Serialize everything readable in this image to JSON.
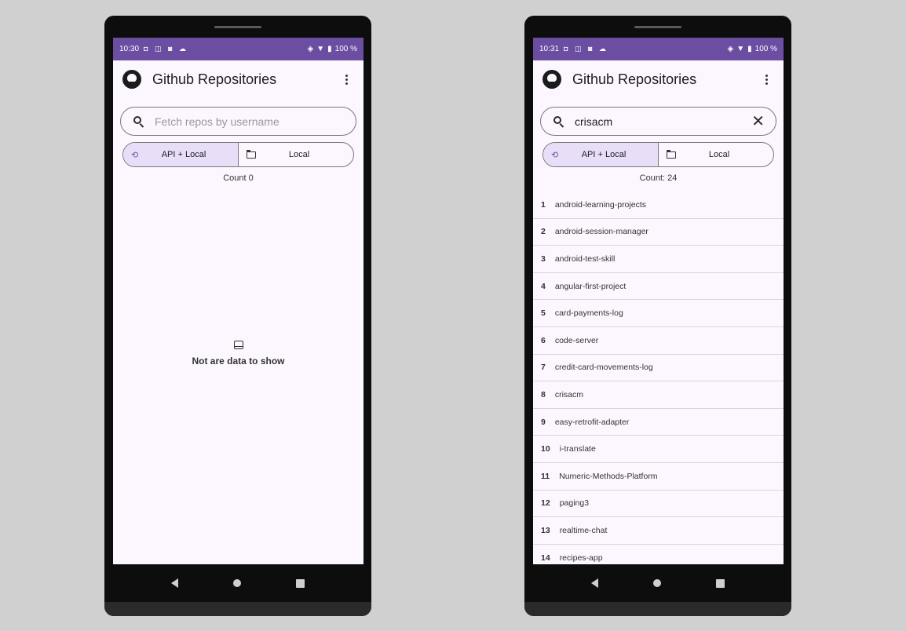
{
  "left": {
    "status": {
      "time": "10:30",
      "battery": "100 %"
    },
    "title": "Github Repositories",
    "search": {
      "placeholder": "Fetch repos by username",
      "value": ""
    },
    "segments": [
      {
        "label": "API + Local",
        "selected": true
      },
      {
        "label": "Local",
        "selected": false
      }
    ],
    "count": "Count 0",
    "empty_message": "Not are data to show"
  },
  "right": {
    "status": {
      "time": "10:31",
      "battery": "100 %"
    },
    "title": "Github Repositories",
    "search": {
      "placeholder": "Fetch repos by username",
      "value": "crisacm"
    },
    "segments": [
      {
        "label": "API + Local",
        "selected": true
      },
      {
        "label": "Local",
        "selected": false
      }
    ],
    "count": "Count: 24",
    "repos": [
      {
        "num": "1",
        "name": "android-learning-projects"
      },
      {
        "num": "2",
        "name": "android-session-manager"
      },
      {
        "num": "3",
        "name": "android-test-skill"
      },
      {
        "num": "4",
        "name": "angular-first-project"
      },
      {
        "num": "5",
        "name": "card-payments-log"
      },
      {
        "num": "6",
        "name": "code-server"
      },
      {
        "num": "7",
        "name": "credit-card-movements-log"
      },
      {
        "num": "8",
        "name": "crisacm"
      },
      {
        "num": "9",
        "name": "easy-retrofit-adapter"
      },
      {
        "num": "10",
        "name": "i-translate"
      },
      {
        "num": "11",
        "name": "Numeric-Methods-Platform"
      },
      {
        "num": "12",
        "name": "paging3"
      },
      {
        "num": "13",
        "name": "realtime-chat"
      },
      {
        "num": "14",
        "name": "recipes-app"
      }
    ]
  },
  "icons": {
    "status_left": [
      "sim-icon",
      "calendar-icon",
      "notification-icon",
      "cloud-icon"
    ],
    "status_right": [
      "vibrate-icon",
      "wifi-icon",
      "battery-icon"
    ],
    "logo": "github-logo-icon",
    "menu": "more-vert-icon",
    "search": "search-icon",
    "clear": "close-icon",
    "segment_api": "sync-icon",
    "segment_local": "folder-icon",
    "empty": "inbox-icon"
  },
  "colors": {
    "status_bar": "#6b4ea2",
    "screen_bg": "#fcf7ff",
    "segment_selected": "#e8def8",
    "page_bg": "#d0d0d0"
  }
}
